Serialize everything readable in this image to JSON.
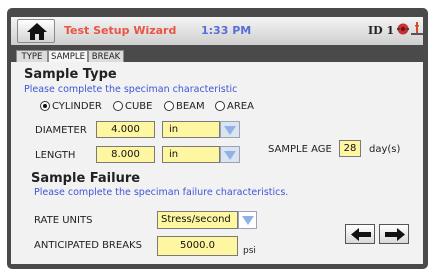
{
  "header": {
    "title": "Test Setup Wizard",
    "time": "1:33 PM",
    "device_id": "ID 1",
    "icons": [
      "home-icon",
      "alert-icon",
      "strain-gauge-icon"
    ]
  },
  "tabs": [
    {
      "label": "TYPE",
      "active": false
    },
    {
      "label": "SAMPLE",
      "active": true
    },
    {
      "label": "BREAK",
      "active": false
    }
  ],
  "sample_type": {
    "heading": "Sample Type",
    "hint": "Please complete the speciman characteristic",
    "options": [
      {
        "label": "CYLINDER",
        "selected": true
      },
      {
        "label": "CUBE",
        "selected": false
      },
      {
        "label": "BEAM",
        "selected": false
      },
      {
        "label": "AREA",
        "selected": false
      }
    ],
    "diameter": {
      "label": "DIAMETER",
      "value": "4.000",
      "unit": "in"
    },
    "length": {
      "label": "LENGTH",
      "value": "8.000",
      "unit": "in"
    },
    "sample_age": {
      "label": "SAMPLE AGE",
      "value": "28",
      "unit": "day(s)"
    }
  },
  "sample_failure": {
    "heading": "Sample Failure",
    "hint": "Please complete the speciman failure characteristics.",
    "rate_units": {
      "label": "RATE UNITS",
      "value": "Stress/second"
    },
    "anticipated_breaks": {
      "label": "ANTICIPATED BREAKS",
      "value": "5000.0",
      "unit": "psi"
    }
  },
  "navigation": {
    "back_icon": "arrow-left-icon",
    "next_icon": "arrow-right-icon"
  },
  "colors": {
    "title": "#e85545",
    "clock": "#5a6ed8",
    "hint": "#3e55d6",
    "field": "#fef6a0",
    "frame": "#4a4a4a"
  }
}
